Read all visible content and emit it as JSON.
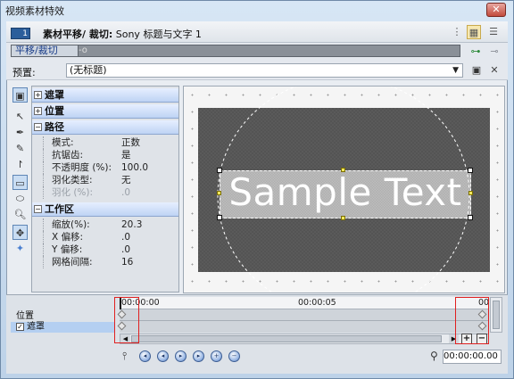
{
  "window": {
    "title": "视频素材特效",
    "close_label": "✕"
  },
  "header": {
    "chain_num": "1",
    "plugin_bold": "素材平移/ 裁切:",
    "plugin_name": "Sony 标题与文字 1"
  },
  "chain": {
    "tab_label": "平移/裁切"
  },
  "preset": {
    "label": "预置:",
    "value": "(无标题)"
  },
  "props": {
    "groups": {
      "mask": "遮罩",
      "position": "位置",
      "path": "路径",
      "workspace": "工作区"
    },
    "path_rows": [
      {
        "name": "模式:",
        "value": "正数"
      },
      {
        "name": "抗锯齿:",
        "value": "是"
      },
      {
        "name": "不透明度 (%):",
        "value": "100.0"
      },
      {
        "name": "羽化类型:",
        "value": "无"
      },
      {
        "name": "羽化 (%):",
        "value": ".0"
      }
    ],
    "workspace_rows": [
      {
        "name": "缩放(%):",
        "value": "20.3"
      },
      {
        "name": "X 偏移:",
        "value": ".0"
      },
      {
        "name": "Y 偏移:",
        "value": ".0"
      },
      {
        "name": "网格间隔:",
        "value": "16"
      }
    ]
  },
  "canvas": {
    "sample_text": "Sample Text"
  },
  "timeline": {
    "tracks": [
      "位置",
      "遮罩"
    ],
    "ruler_start": "00:00:00",
    "ruler_mid": "00:00:05",
    "ruler_end": "00",
    "time_value": "00:00:00.00"
  }
}
